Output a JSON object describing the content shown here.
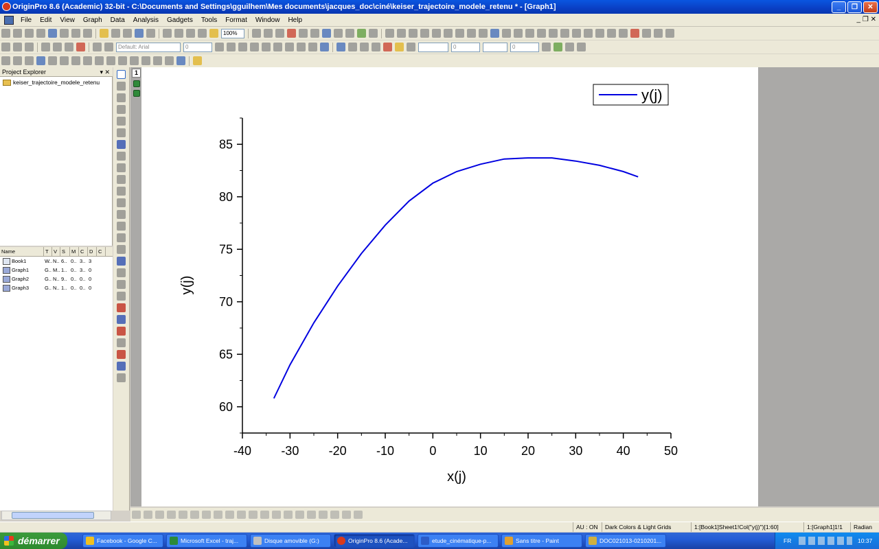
{
  "window": {
    "title": "OriginPro 8.6 (Academic) 32-bit - C:\\Documents and Settings\\gguilhem\\Mes documents\\jacques_doc\\ciné\\keiser_trajectoire_modele_retenu * - [Graph1]"
  },
  "menu": [
    "File",
    "Edit",
    "View",
    "Graph",
    "Data",
    "Analysis",
    "Gadgets",
    "Tools",
    "Format",
    "Window",
    "Help"
  ],
  "toolbar": {
    "zoom": "100%",
    "font": "Default: Arial",
    "size1": "0",
    "size2": "0",
    "size3": "0"
  },
  "project_explorer": {
    "title": "Project Explorer",
    "folder": "keiser_trajectoire_modele_retenu",
    "columns": [
      "Name",
      "T",
      "V",
      "S",
      "M",
      "C",
      "D",
      "C"
    ],
    "items": [
      {
        "name": "Book1",
        "t": "W..",
        "v": "N..",
        "s": "6..",
        "m": "0..",
        "c": "3..",
        "d": "3"
      },
      {
        "name": "Graph1",
        "t": "G..",
        "v": "M..",
        "s": "1..",
        "m": "0..",
        "c": "3..",
        "d": "0"
      },
      {
        "name": "Graph2",
        "t": "G..",
        "v": "N..",
        "s": "9..",
        "m": "0..",
        "c": "0..",
        "d": "0"
      },
      {
        "name": "Graph3",
        "t": "G..",
        "v": "N..",
        "s": "1..",
        "m": "0..",
        "c": "0..",
        "d": "0"
      }
    ]
  },
  "layer_label": "1",
  "chart_data": {
    "type": "line",
    "xlabel": "x(j)",
    "ylabel": "y(j)",
    "xlim": [
      -40,
      50
    ],
    "ylim": [
      57.5,
      87.5
    ],
    "xticks": [
      -40,
      -30,
      -20,
      -10,
      0,
      10,
      20,
      30,
      40,
      50
    ],
    "yticks": [
      60,
      65,
      70,
      75,
      80,
      85
    ],
    "series": [
      {
        "name": "y(j)",
        "color": "#0000e0",
        "x": [
          -33.4,
          -30,
          -25,
          -20,
          -15,
          -10,
          -5,
          0,
          5,
          10,
          15,
          20,
          25,
          30,
          35,
          40,
          43.1
        ],
        "y": [
          60.8,
          64.0,
          68.0,
          71.5,
          74.6,
          77.3,
          79.6,
          81.3,
          82.4,
          83.1,
          83.6,
          83.7,
          83.7,
          83.4,
          83.0,
          82.4,
          81.9
        ]
      }
    ],
    "legend": "top-right"
  },
  "status": {
    "au": "AU : ON",
    "theme": "Dark Colors & Light Grids",
    "sheet": "1:[Book1]Sheet1!Col(\"y(j)\")[1:60]",
    "layer": "1:[Graph1]1!1",
    "angle": "Radian"
  },
  "taskbar": {
    "start": "démarrer",
    "tasks": [
      "Facebook - Google C...",
      "Microsoft Excel - traj...",
      "Disque amovible (G:)",
      "OriginPro 8.6 (Acade...",
      "etude_cinématique-p...",
      "Sans titre - Paint",
      "DOC021013-0210201..."
    ],
    "lang": "FR",
    "time": "10:37"
  }
}
